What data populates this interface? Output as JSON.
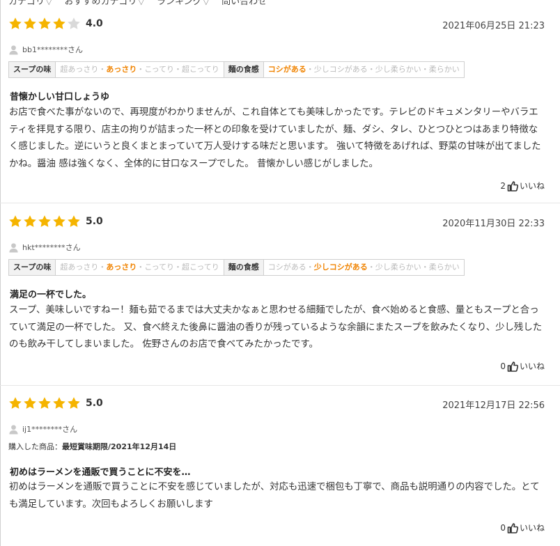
{
  "nav": {
    "items": [
      "カテゴリ",
      "おすすめカテゴリ",
      "ランキング",
      "問い合わせ"
    ]
  },
  "colors": {
    "star": "#f5b400",
    "star_empty": "#d9d9d9",
    "accent": "#f08300"
  },
  "reviews": [
    {
      "rating": 4,
      "score": "4.0",
      "date": "2021年06月25日 21:23",
      "user": "bb1********さん",
      "tastes": [
        {
          "label": "スープの味",
          "options": [
            "超あっさり",
            "あっさり",
            "こってり",
            "超こってり"
          ],
          "selected": 1
        },
        {
          "label": "麺の食感",
          "options": [
            "コシがある",
            "少しコシがある",
            "少し柔らかい",
            "柔らかい"
          ],
          "selected": 0
        }
      ],
      "title": "昔懐かしい甘口しょうゆ",
      "body": "お店で食べた事がないので、再現度がわかりませんが、これ自体とても美味しかったです。テレビのドキュメンタリーやバラエティを拝見する限り、店主の拘りが詰まった一杯との印象を受けていましたが、麺、ダシ、タレ、ひとつひとつはあまり特徴なく感じました。逆にいうと良くまとまっていて万人受けする味だと思います。 強いて特徴をあげれば、野菜の甘味が出てましたかね。醤油 感は強くなく、全体的に甘口なスープでした。 昔懐かしい感じがしました。",
      "likes": "2",
      "like_label": "いいね"
    },
    {
      "rating": 5,
      "score": "5.0",
      "date": "2020年11月30日 22:33",
      "user": "hkt********さん",
      "tastes": [
        {
          "label": "スープの味",
          "options": [
            "超あっさり",
            "あっさり",
            "こってり",
            "超こってり"
          ],
          "selected": 1
        },
        {
          "label": "麺の食感",
          "options": [
            "コシがある",
            "少しコシがある",
            "少し柔らかい",
            "柔らかい"
          ],
          "selected": 1
        }
      ],
      "title": "満足の一杯でした。",
      "body": "スープ、美味しいですねー！麺も茹でるまでは大丈夫かなぁと思わせる細麺でしたが、食べ始めると食感、量ともスープと合っていて満足の一杯でした。 又、食べ終えた後鼻に醤油の香りが残っているような余韻にまたスープを飲みたくなり、少し残したのも飲み干してしまいました。 佐野さんのお店で食べてみたかったです。",
      "likes": "0",
      "like_label": "いいね"
    },
    {
      "rating": 5,
      "score": "5.0",
      "date": "2021年12月17日 22:56",
      "user": "ij1********さん",
      "purchased_label": "購入した商品：",
      "purchased_value": "最短賞味期限/2021年12月14日",
      "title": "初めはラーメンを通販で買うことに不安を…",
      "body": "初めはラーメンを通販で買うことに不安を感じていましたが、対応も迅速で梱包も丁寧で、商品も説明通りの内容でした。とても満足しています。次回もよろしくお願いします",
      "likes": "0",
      "like_label": "いいね"
    }
  ]
}
